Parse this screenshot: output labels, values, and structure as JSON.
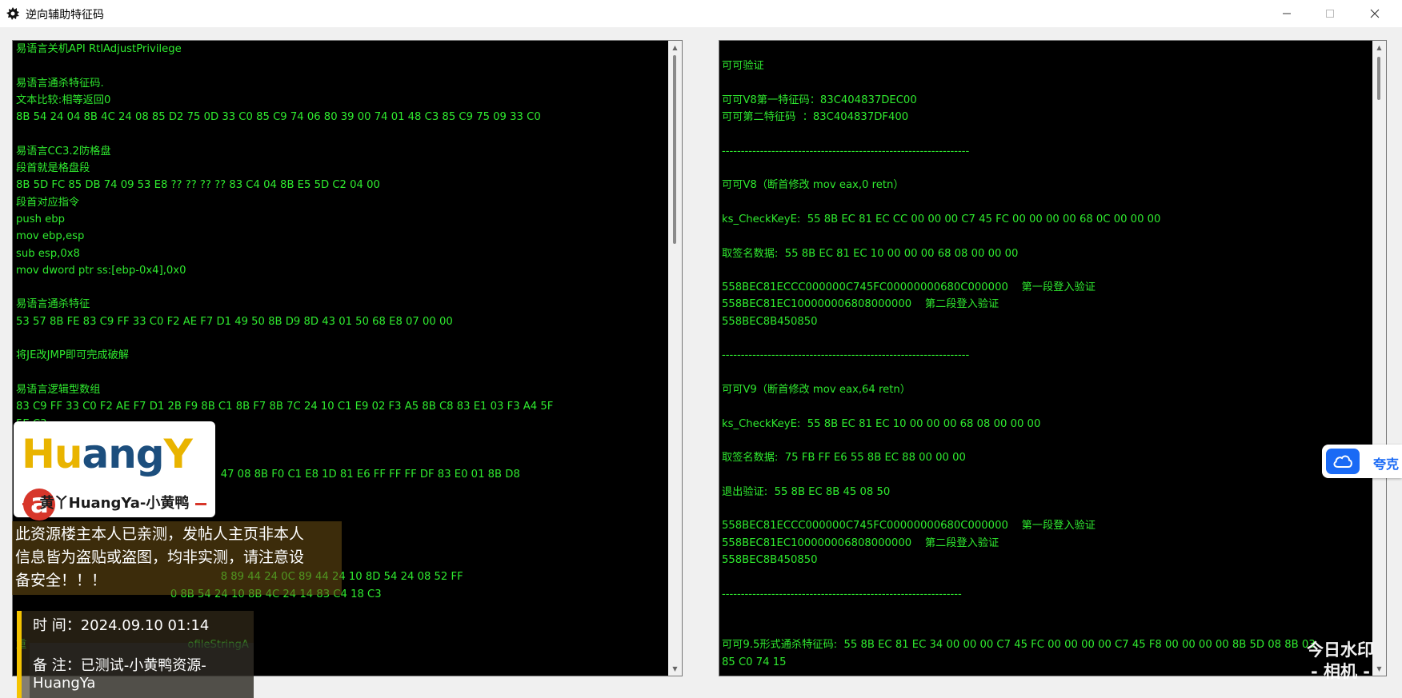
{
  "window": {
    "title": "逆向辅助特征码",
    "controls": {
      "minimize": "—",
      "maximize": "☐",
      "close": "✕"
    }
  },
  "left_pane": {
    "lines": [
      "易语言关机API RtlAdjustPrivilege",
      "",
      "易语言通杀特征码.",
      "文本比较:相等返回0",
      "8B 54 24 04 8B 4C 24 08 85 D2 75 0D 33 C0 85 C9 74 06 80 39 00 74 01 48 C3 85 C9 75 09 33 C0",
      "",
      "易语言CC3.2防格盘",
      "段首就是格盘段",
      "8B 5D FC 85 DB 74 09 53 E8 ?? ?? ?? ?? 83 C4 04 8B E5 5D C2 04 00",
      "段首对应指令",
      "push ebp",
      "mov ebp,esp",
      "sub esp,0x8",
      "mov dword ptr ss:[ebp-0x4],0x0",
      "",
      "易语言通杀特征",
      "53 57 8B FE 83 C9 FF 33 C0 F2 AE F7 D1 49 50 8B D9 8D 43 01 50 68 E8 07 00 00",
      "",
      "将JE改JMP即可完成破解",
      "",
      "易语言逻辑型数组",
      "83 C9 FF 33 C0 F2 AE F7 D1 2B F9 8B C1 8B F7 8B 7C 24 10 C1 E9 02 F3 A5 8B C8 83 E1 03 F3 A4 5F",
      "5E C3",
      "",
      "",
      "                                                             47 08 8B F0 C1 E8 1D 81 E6 FF FF FF DF 83 E0 01 8B D8",
      "",
      "",
      "",
      "",
      "",
      "                                                             8 89 44 24 0C 89 44 24 10 8D 54 24 08 52 FF",
      "                                              0 8B 54 24 10 8B 4C 24 14 83 C4 18 C3",
      "",
      "",
      "重                                                ofileStringA",
      "",
      "-----------------------------------------------------------------"
    ]
  },
  "right_pane": {
    "lines": [
      "",
      "可可验证",
      "",
      "可可V8第一特征码：83C404837DEC00",
      "可可第二特征码  ：83C404837DF400",
      "",
      "-----------------------------------------------------------------",
      "",
      "可可V8（断首修改 mov eax,0 retn）",
      "",
      "ks_CheckKeyE:  55 8B EC 81 EC CC 00 00 00 C7 45 FC 00 00 00 00 68 0C 00 00 00",
      "",
      "取签名数据:  55 8B EC 81 EC 10 00 00 00 68 08 00 00 00",
      "",
      "558BEC81ECCC000000C745FC00000000680C000000    第一段登入验证",
      "558BEC81EC100000006808000000    第二段登入验证",
      "558BEC8B450850",
      "",
      "-----------------------------------------------------------------",
      "",
      "可可V9（断首修改 mov eax,64 retn）",
      "",
      "ks_CheckKeyE:  55 8B EC 81 EC 10 00 00 00 68 08 00 00 00",
      "",
      "取签名数据:  75 FB FF E6 55 8B EC 88 00 00 00",
      "",
      "退出验证:  55 8B EC 8B 45 08 50",
      "",
      "558BEC81ECCC000000C745FC00000000680C000000    第一段登入验证",
      "558BEC81EC100000006808000000    第二段登入验证",
      "558BEC8B450850",
      "",
      "---------------------------------------------------------------",
      "",
      "",
      "可可9.5形式通杀特征码:  55 8B EC 81 EC 34 00 00 00 C7 45 FC 00 00 00 00 C7 45 F8 00 00 00 00 8B 5D 08 8B 03",
      "85 C0 74 15"
    ]
  },
  "overlay": {
    "logo_hu": "Hu",
    "logo_ang": "ang",
    "logo_y": "Y",
    "logo_a": "a",
    "logo_caption": "黄丫HuangYa-小黄鸭",
    "notice": "此资源楼主本人已亲测，发帖人主页非本人\n信息皆为盗贴或盗图，均非实测，请注意设\n备安全！！！",
    "time_row": "时    间：2024.09.10 01:14",
    "note_row": "备    注：已测试-小黄鸭资源-HuangYa",
    "quark_label": "夸克",
    "watermark_right": "今日水印\n- 相机 -"
  },
  "colors": {
    "console_text": "#2fea2f",
    "console_bg": "#000000",
    "logo_yellow": "#e9b400",
    "logo_blue": "#1c4e7d",
    "logo_red": "#d7362a",
    "quark_blue": "#1a6af5"
  }
}
